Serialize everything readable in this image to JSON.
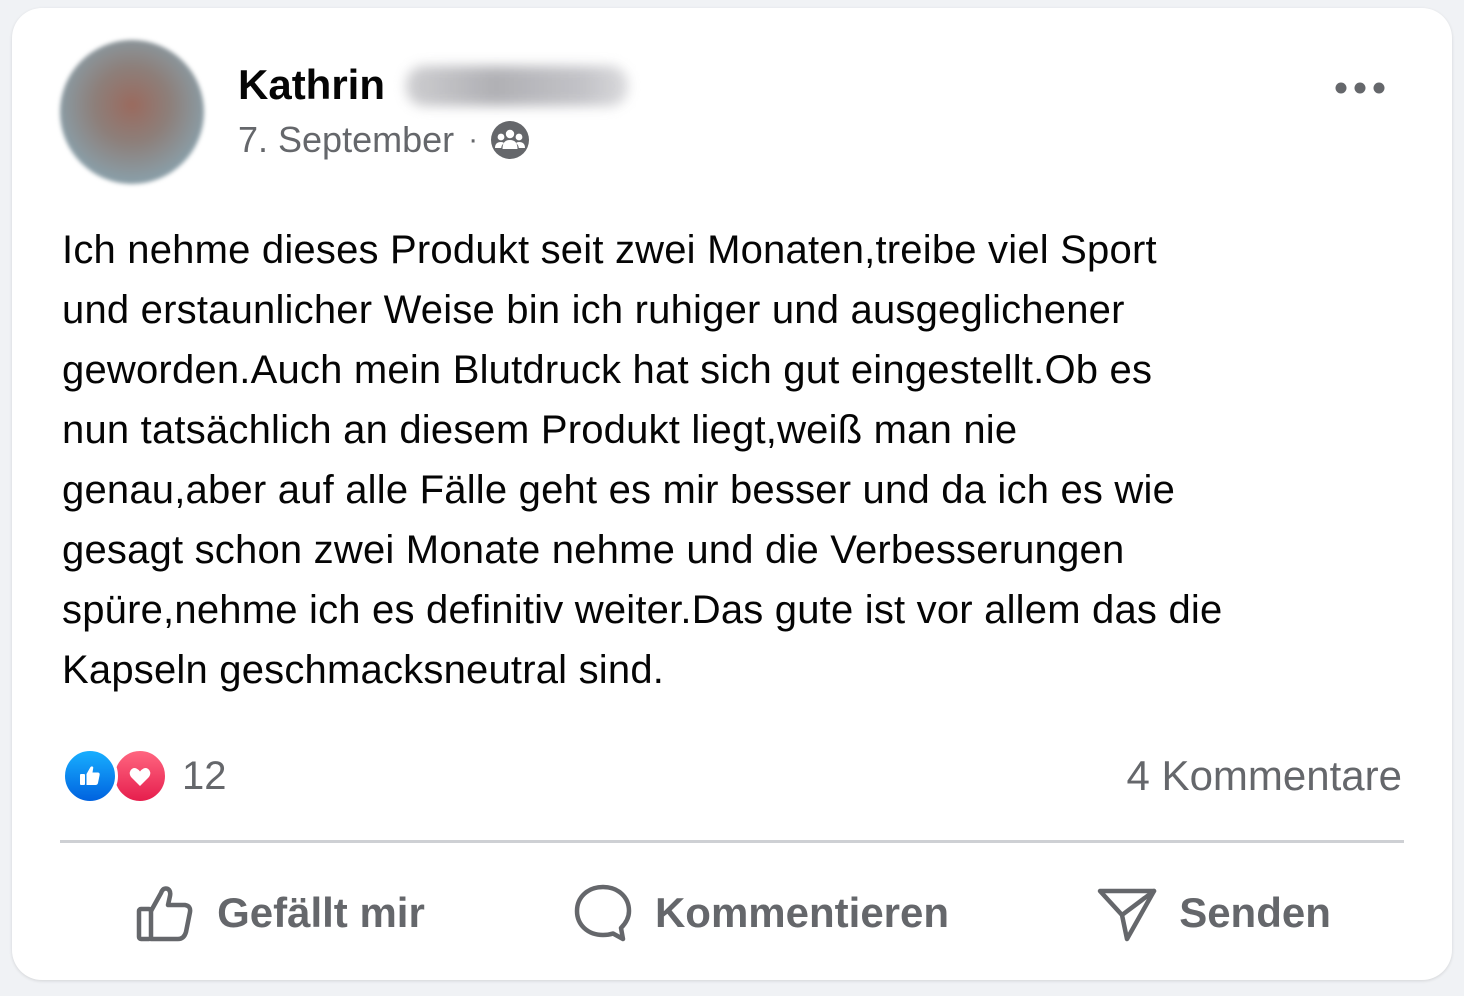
{
  "post": {
    "author_first_name": "Kathrin",
    "date": "7. September",
    "separator": "·",
    "audience_icon": "group-icon",
    "more_icon": "more-horizontal-icon",
    "text": "Ich nehme dieses Produkt seit zwei Monaten,treibe viel Sport\nund erstaunlicher Weise bin ich ruhiger und ausgeglichener\ngeworden.Auch mein Blutdruck hat sich gut eingestellt.Ob es\nnun tatsächlich an diesem Produkt liegt,weiß man nie\ngenau,aber auf alle Fälle geht es mir besser und da ich es wie\ngesagt schon zwei Monate nehme und die Verbesserungen\nspüre,nehme ich es definitiv weiter.Das gute ist vor allem das die\nKapseln geschmacksneutral sind."
  },
  "stats": {
    "reaction_icons": [
      "like-reaction-icon",
      "love-reaction-icon"
    ],
    "reaction_count": "12",
    "comments_label": "4 Kommentare"
  },
  "actions": {
    "like_label": "Gefällt mir",
    "comment_label": "Kommentieren",
    "share_label": "Senden"
  },
  "colors": {
    "text_primary": "#050505",
    "text_secondary": "#65676b",
    "like_blue": "#0866ff",
    "love_red": "#f33e58",
    "divider": "#ced0d4"
  }
}
